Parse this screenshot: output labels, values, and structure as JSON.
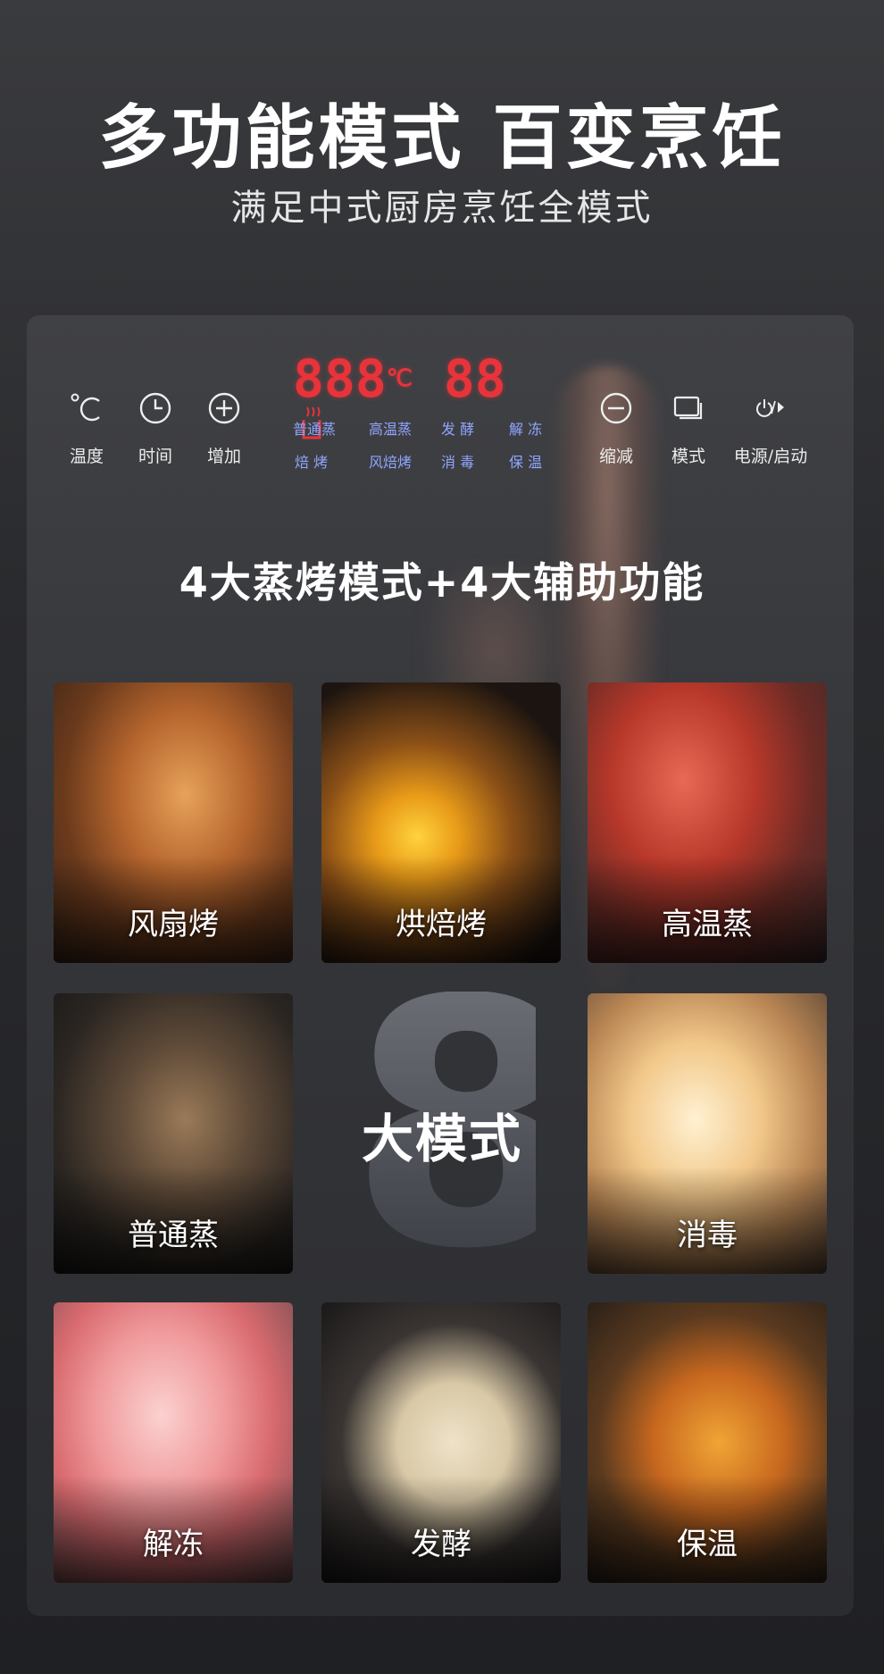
{
  "header": {
    "title": "多功能模式  百变烹饪",
    "subtitle": "满足中式厨房烹饪全模式"
  },
  "panel": {
    "controls_left": [
      {
        "icon": "celsius-icon",
        "label": "温度"
      },
      {
        "icon": "clock-icon",
        "label": "时间"
      },
      {
        "icon": "plus-circle-icon",
        "label": "增加"
      }
    ],
    "controls_right": [
      {
        "icon": "minus-circle-icon",
        "label": "缩减"
      },
      {
        "icon": "mode-icon",
        "label": "模式"
      },
      {
        "icon": "power-start-icon",
        "label": "电源/启动"
      }
    ],
    "display": {
      "temp_digits": "888",
      "temp_unit": "℃",
      "time_digits": "88",
      "steam_icon": "steam-cup-icon"
    },
    "display_modes": {
      "row1": [
        "普通蒸",
        "高温蒸",
        "发 酵",
        "解 冻"
      ],
      "row2": [
        "焙 烤",
        "风焙烤",
        "消 毒",
        "保 温"
      ]
    },
    "display_color": "#e8333a",
    "mode_label_color": "#8fa6ff"
  },
  "headline": "4大蒸烤模式+4大辅助功能",
  "center": {
    "numeral": "8",
    "label": "大模式"
  },
  "tiles": [
    {
      "label": "风扇烤"
    },
    {
      "label": "烘焙烤"
    },
    {
      "label": "高温蒸"
    },
    {
      "label": "普通蒸"
    },
    {
      "label": "消毒"
    },
    {
      "label": "解冻"
    },
    {
      "label": "发酵"
    },
    {
      "label": "保温"
    }
  ]
}
